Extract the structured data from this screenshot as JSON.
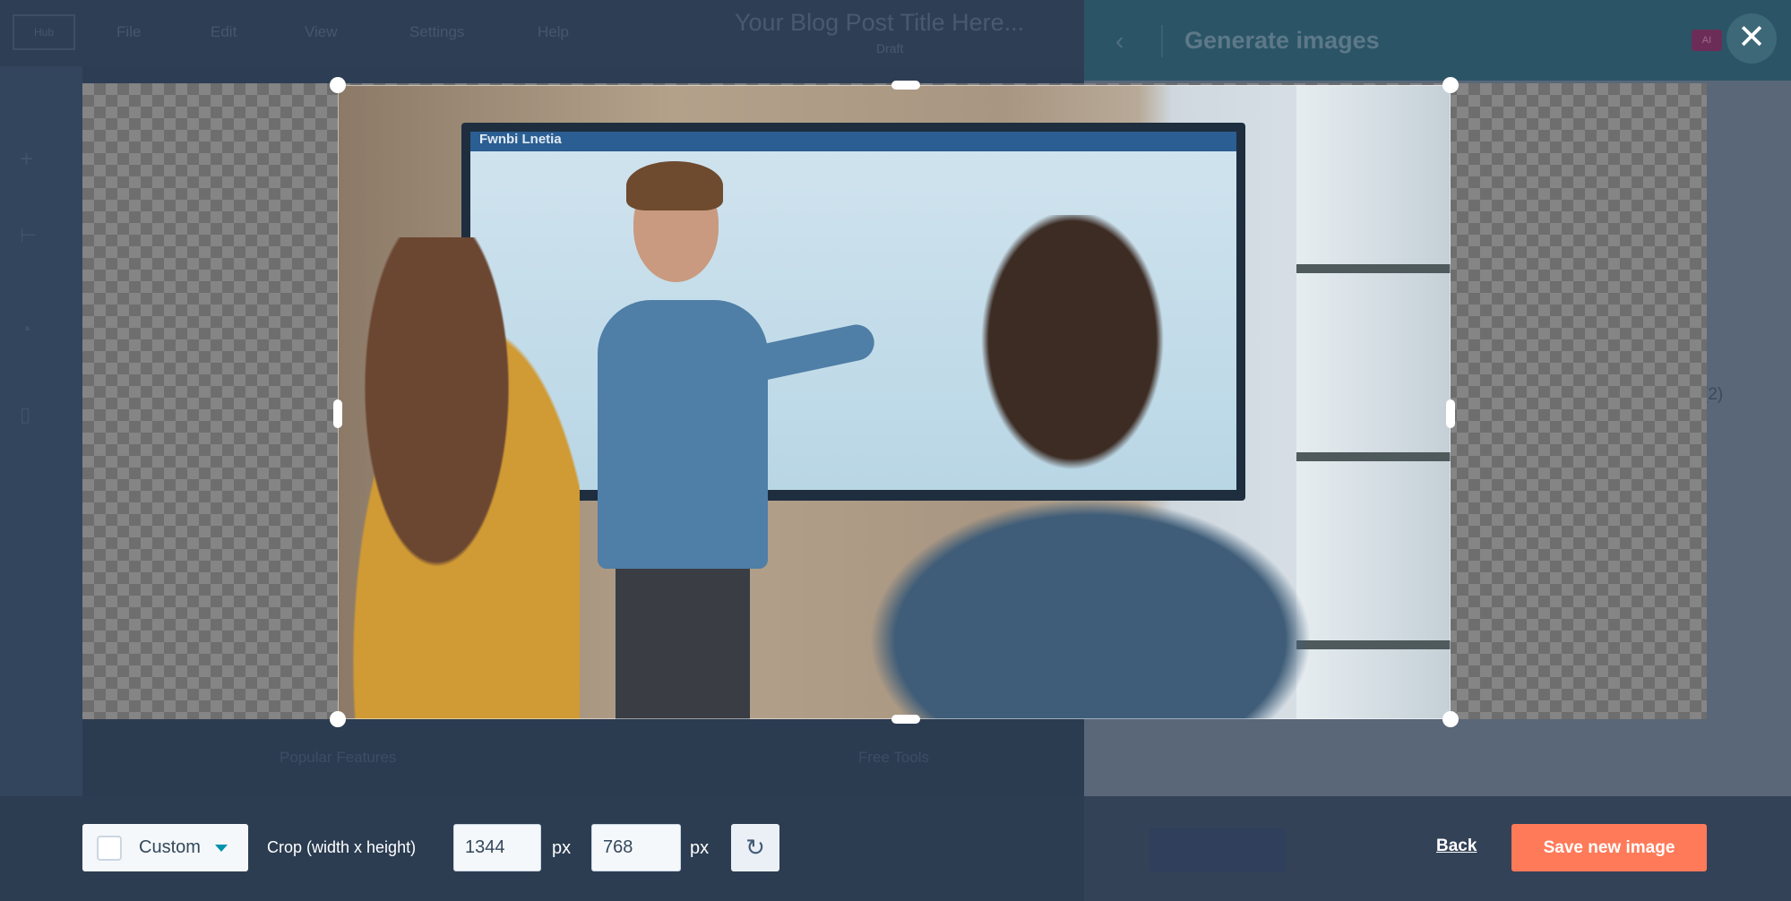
{
  "editor": {
    "logo_text": "Hub",
    "menu": [
      "File",
      "Edit",
      "View",
      "Settings",
      "Help"
    ],
    "blog_title": "Your Blog Post Title Here...",
    "status": "Draft",
    "footer_columns": [
      "Popular Features",
      "Free Tools"
    ]
  },
  "panel": {
    "title": "Generate images",
    "ai_badge": "AI",
    "count_text": "(2)"
  },
  "image": {
    "screen_title": "Fwnbi Lnetia"
  },
  "crop_toolbar": {
    "aspect_selected": "Custom",
    "crop_label": "Crop (width x height)",
    "width": "1344",
    "height": "768",
    "unit": "px",
    "back_label": "Back",
    "save_label": "Save new image"
  },
  "colors": {
    "primary_button": "#ff7a59",
    "panel_header": "#2b5566",
    "caret": "#0091ae"
  }
}
